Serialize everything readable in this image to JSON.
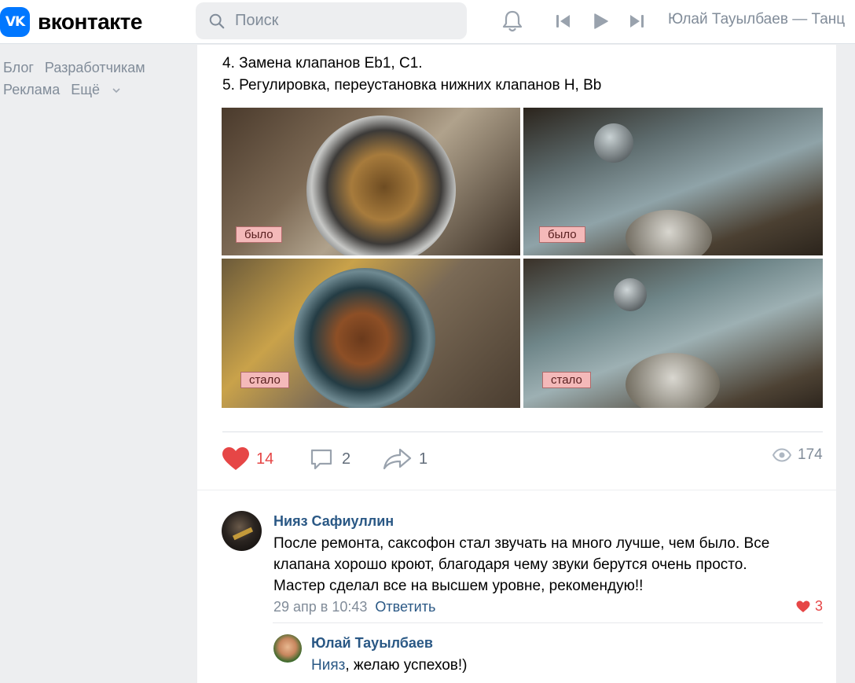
{
  "header": {
    "logo_badge": "VK",
    "logo_text": "вконтакте",
    "search_placeholder": "Поиск",
    "now_playing": "Юлай Тауылбаев — Танц"
  },
  "sidebar": {
    "links": [
      "Блог",
      "Разработчикам",
      "Реклама",
      "Ещё"
    ]
  },
  "post": {
    "lines": [
      "4. Замена клапанов Eb1, C1.",
      "5. Регулировка, переустановка нижних клапанов H, Bb"
    ],
    "photos": [
      {
        "label": "было"
      },
      {
        "label": "было"
      },
      {
        "label": "стало"
      },
      {
        "label": "стало"
      }
    ],
    "likes": "14",
    "comments": "2",
    "shares": "1",
    "views": "174",
    "colors": {
      "like": "#e64646",
      "icon": "#99a2ad"
    }
  },
  "comments": [
    {
      "author": "Нияз Сафиуллин",
      "text_lines": [
        "После ремонта, саксофон стал звучать на много лучше, чем было. Все",
        "клапана хорошо кроют, благодаря чему звуки берутся очень просто.",
        "Мастер сделал все на высшем уровне, рекомендую!!"
      ],
      "date": "29 апр в 10:43",
      "reply_label": "Ответить",
      "likes": "3"
    },
    {
      "author": "Юлай Тауылбаев",
      "mention": "Нияз",
      "text": ", желаю успехов!)"
    }
  ]
}
